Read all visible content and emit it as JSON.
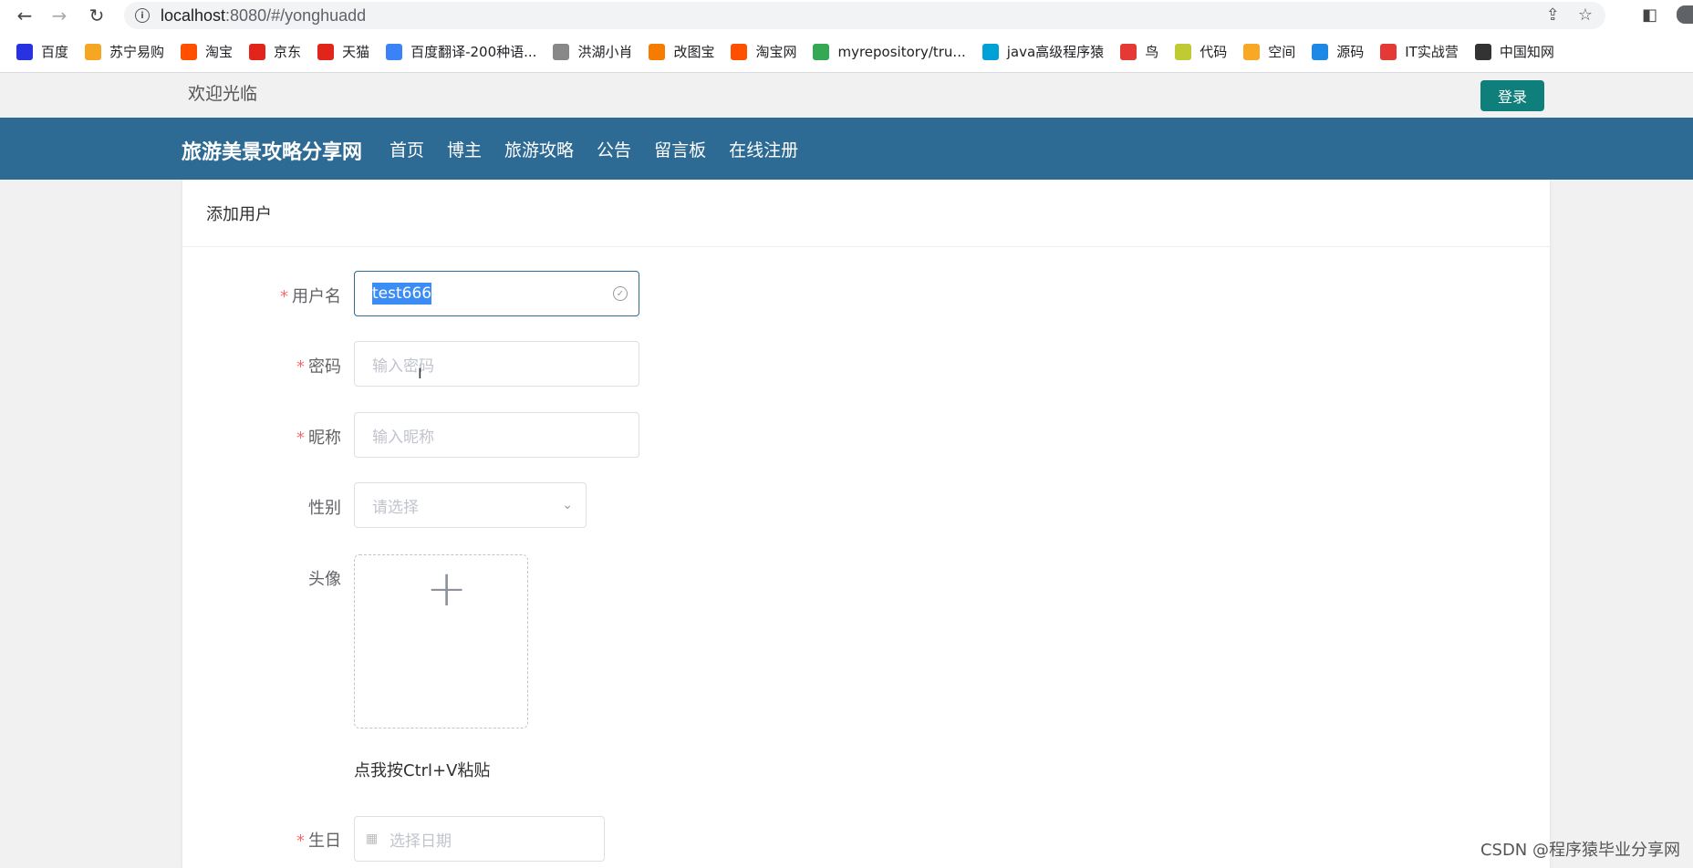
{
  "browser": {
    "url_host": "localhost",
    "url_path": ":8080/#/yonghuadd",
    "bookmarks": [
      {
        "label": "百度",
        "color": "#2932e1",
        "icon": "paw-icon"
      },
      {
        "label": "苏宁易购",
        "color": "#f5a623",
        "icon": "lion-icon"
      },
      {
        "label": "淘宝",
        "color": "#ff5000",
        "icon": "taobao-icon"
      },
      {
        "label": "京东",
        "color": "#e1251b",
        "icon": "jd-icon"
      },
      {
        "label": "天猫",
        "color": "#e1251b",
        "icon": "tmall-icon"
      },
      {
        "label": "百度翻译-200种语...",
        "color": "#3b82f6",
        "icon": "translate-icon"
      },
      {
        "label": "洪湖小肖",
        "color": "#888888",
        "icon": "bird-icon"
      },
      {
        "label": "改图宝",
        "color": "#f57c00",
        "icon": "image-icon"
      },
      {
        "label": "淘宝网",
        "color": "#ff5000",
        "icon": "taobao-icon"
      },
      {
        "label": "myrepository/tru...",
        "color": "#34a853",
        "icon": "chrome-icon"
      },
      {
        "label": "java高级程序猿",
        "color": "#00a1d6",
        "icon": "tv-icon"
      },
      {
        "label": "鸟",
        "color": "#e53935",
        "icon": "bird-icon"
      },
      {
        "label": "代码",
        "color": "#c0ca33",
        "icon": "code-icon"
      },
      {
        "label": "空间",
        "color": "#f9a825",
        "icon": "space-icon"
      },
      {
        "label": "源码",
        "color": "#1e88e5",
        "icon": "whale-icon"
      },
      {
        "label": "IT实战营",
        "color": "#e53935",
        "icon": "chrome-icon"
      },
      {
        "label": "中国知网",
        "color": "#333333",
        "icon": "cnki-icon"
      }
    ]
  },
  "header": {
    "welcome": "欢迎光临",
    "login_label": "登录"
  },
  "navbar": {
    "brand": "旅游美景攻略分享网",
    "items": [
      "首页",
      "博主",
      "旅游攻略",
      "公告",
      "留言板",
      "在线注册"
    ]
  },
  "form": {
    "title": "添加用户",
    "username": {
      "label": "用户名",
      "value": "test666"
    },
    "password": {
      "label": "密码",
      "placeholder": "输入密码"
    },
    "nickname": {
      "label": "昵称",
      "placeholder": "输入昵称"
    },
    "gender": {
      "label": "性别",
      "placeholder": "请选择"
    },
    "avatar": {
      "label": "头像",
      "paste_hint": "点我按Ctrl+V粘贴"
    },
    "birthday": {
      "label": "生日",
      "placeholder": "选择日期"
    }
  },
  "watermark": "CSDN @程序猿毕业分享网",
  "colors": {
    "navbar": "#2d6a94",
    "login_button": "#0e7f7a",
    "required": "#f56c6c"
  }
}
